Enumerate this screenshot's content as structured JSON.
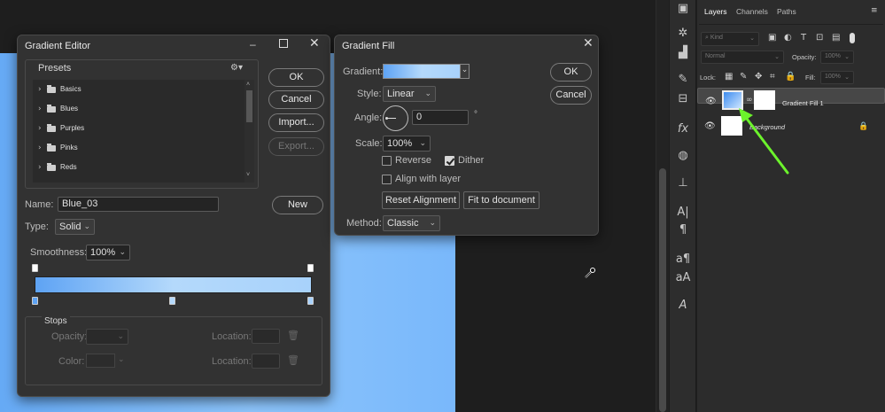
{
  "layers_panel": {
    "tabs": [
      "Layers",
      "Channels",
      "Paths"
    ],
    "kind_filter": "Kind",
    "blend_mode": "Normal",
    "opacity_label": "Opacity:",
    "opacity_value": "100%",
    "lock_label": "Lock:",
    "fill_label": "Fill:",
    "fill_value": "100%",
    "layers": [
      {
        "name": "Gradient Fill 1"
      },
      {
        "name": "Background"
      }
    ]
  },
  "gradient_editor": {
    "title": "Gradient Editor",
    "presets_label": "Presets",
    "presets": [
      "Basics",
      "Blues",
      "Purples",
      "Pinks",
      "Reds"
    ],
    "ok": "OK",
    "cancel": "Cancel",
    "import": "Import...",
    "export": "Export...",
    "name_label": "Name:",
    "name_value": "Blue_03",
    "new": "New",
    "type_label": "Type:",
    "type_value": "Solid",
    "smoothness_label": "Smoothness:",
    "smoothness_value": "100%",
    "stops_label": "Stops",
    "opacity_label": "Opacity:",
    "color_label": "Color:",
    "location_label": "Location:",
    "colors": {
      "left": "#5ea3f4",
      "mid": "#b4d9fb",
      "right": "#a8d2fb"
    }
  },
  "gradient_fill": {
    "title": "Gradient Fill",
    "gradient_label": "Gradient:",
    "style_label": "Style:",
    "style_value": "Linear",
    "angle_label": "Angle:",
    "angle_value": "0",
    "angle_unit": "°",
    "scale_label": "Scale:",
    "scale_value": "100%",
    "reverse_label": "Reverse",
    "reverse_checked": false,
    "dither_label": "Dither",
    "dither_checked": true,
    "align_label": "Align with layer",
    "align_checked": false,
    "reset_alignment": "Reset Alignment",
    "fit_to_document": "Fit to document",
    "method_label": "Method:",
    "method_value": "Classic",
    "ok": "OK",
    "cancel": "Cancel"
  },
  "annotation": {
    "arrow_color": "#6cf32c"
  }
}
